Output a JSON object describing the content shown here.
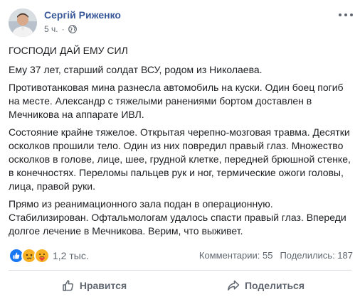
{
  "post": {
    "author": "Сергій Риженко",
    "time": "5 ч.",
    "dot": "·",
    "icons": [
      "globe-icon",
      "more-options-icon"
    ],
    "paragraphs": [
      "ГОСПОДИ ДАЙ ЕМУ СИЛ",
      "Ему 37 лет, старший солдат ВСУ, родом из Николаева.",
      "Противотанковая мина разнесла автомобиль на куски. Один боец погиб на месте. Александр с тяжелыми ранениями бортом доставлен в Мечникова на аппарате ИВЛ.",
      "Состояние крайне тяжелое. Открытая черепно-мозговая травма. Десятки осколков прошили тело. Один из них повредил правый глаз. Множество осколков в голове, лице, шее, грудной клетке, передней брюшной стенке, в конечностях. Переломы пальцев рук и ног, термические ожоги головы, лица, правой руки.",
      "Прямо из реанимационного зала подан в операционную. Стабилизирован. Офтальмологам удалось спасти правый глаз. Впереди долгое лечение в Мечникова. Верим, что выживет."
    ]
  },
  "reactions": {
    "icons": [
      "like-reaction-icon",
      "sad-reaction-icon",
      "care-reaction-icon"
    ],
    "count": "1,2 тыс."
  },
  "stats": {
    "comments": "Комментарии: 55",
    "shares": "Поделились: 187"
  },
  "actions": {
    "like_label": "Нравится",
    "share_label": "Поделиться"
  },
  "colors": {
    "author": "#385898",
    "secondary_text": "#606770",
    "like_blue": "#1877f2",
    "sad_yellow": "#f7b125"
  }
}
